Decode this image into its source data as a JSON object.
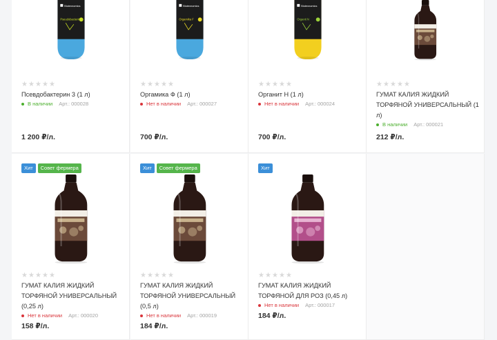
{
  "rows": [
    {
      "cards": [
        {
          "title": "Псевдобактерин 3 (1 л)",
          "availability": "В наличии",
          "in_stock": true,
          "sku": "Арт.: 000028",
          "price": "1 200 ₽/л.",
          "stickers": [],
          "bottle": {
            "kind": "tall",
            "body": "#4aa8de",
            "label": "#1c1c1c",
            "accent": "#c7dd23",
            "brand": "Biotexnomics",
            "name": "Pseudobacterin"
          }
        },
        {
          "title": "Оргамика Ф (1 л)",
          "availability": "Нет в наличии",
          "in_stock": false,
          "sku": "Арт.: 000027",
          "price": "700 ₽/л.",
          "stickers": [],
          "bottle": {
            "kind": "tall",
            "body": "#4aa8de",
            "label": "#1c1c1c",
            "accent": "#e8d823",
            "brand": "Biotexnomics",
            "name": "Orgamika F"
          }
        },
        {
          "title": "Органит Н (1 л)",
          "availability": "Нет в наличии",
          "in_stock": false,
          "sku": "Арт.: 000024",
          "price": "700 ₽/л.",
          "stickers": [],
          "bottle": {
            "kind": "tall",
            "body": "#f2cf1f",
            "label": "#1c1c1c",
            "accent": "#9cd23a",
            "brand": "Biotexnomics",
            "name": "Organit N"
          }
        },
        {
          "title": "ГУМАТ КАЛИЯ ЖИДКИЙ ТОРФЯНОЙ УНИВЕРСАЛЬНЫЙ (1 л)",
          "availability": "В наличии",
          "in_stock": true,
          "sku": "Арт.: 000021",
          "price": "212 ₽/л.",
          "stickers": [],
          "bottle": {
            "kind": "dark",
            "body": "#2a1814",
            "label": "#6b4a3a",
            "accent": "#c9b28c",
            "brand": "",
            "name": ""
          }
        }
      ]
    },
    {
      "cards": [
        {
          "title": "ГУМАТ КАЛИЯ ЖИДКИЙ ТОРФЯНОЙ УНИВЕРСАЛЬНЫЙ (0,25 л)",
          "availability": "Нет в наличии",
          "in_stock": false,
          "sku": "Арт.: 000020",
          "price": "158 ₽/л.",
          "stickers": [
            "Хит",
            "Совет фермера"
          ],
          "bottle": {
            "kind": "dark",
            "body": "#2a1814",
            "label": "#6b4a3a",
            "accent": "#c9b28c",
            "brand": "",
            "name": ""
          }
        },
        {
          "title": "ГУМАТ КАЛИЯ ЖИДКИЙ ТОРФЯНОЙ УНИВЕРСАЛЬНЫЙ (0,5 л)",
          "availability": "Нет в наличии",
          "in_stock": false,
          "sku": "Арт.: 000019",
          "price": "184 ₽/л.",
          "stickers": [
            "Хит",
            "Совет фермера"
          ],
          "bottle": {
            "kind": "dark",
            "body": "#2a1814",
            "label": "#6b4a3a",
            "accent": "#c9b28c",
            "brand": "",
            "name": ""
          }
        },
        {
          "title": "ГУМАТ КАЛИЯ ЖИДКИЙ ТОРФЯНОЙ ДЛЯ РОЗ (0,45 л)",
          "availability": "Нет в наличии",
          "in_stock": false,
          "sku": "Арт.: 000017",
          "price": "184 ₽/л.",
          "stickers": [
            "Хит"
          ],
          "bottle": {
            "kind": "dark",
            "body": "#2a1814",
            "label": "#b24f8a",
            "accent": "#e7b4d2",
            "brand": "",
            "name": ""
          }
        }
      ]
    }
  ],
  "rating": {
    "max": 5,
    "value": 0
  },
  "colors": {
    "in_stock": "#4caf2e",
    "out_of_stock": "#d9343a",
    "sticker_hit": "#3b8fd8",
    "sticker_advice": "#55b54b"
  },
  "icons": {
    "star": "star-icon",
    "status": "status-dot-icon"
  }
}
